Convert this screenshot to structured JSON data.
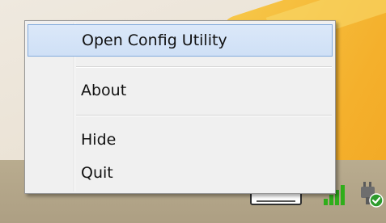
{
  "context_menu": {
    "items": [
      {
        "label": "Open Config Utility",
        "highlighted": true
      },
      {
        "label": "About",
        "highlighted": false
      },
      {
        "label": "Hide",
        "highlighted": false
      },
      {
        "label": "Quit",
        "highlighted": false
      }
    ]
  },
  "tray_icons": [
    "keyboard-icon",
    "signal-strength-icon",
    "power-check-icon"
  ],
  "colors": {
    "menu_background": "#f0f0f0",
    "highlight_fill": "#d5e4f7",
    "highlight_border": "#84acdd",
    "taskbar": "#b3a589",
    "wallpaper_accent": "#f4b02c",
    "signal_green": "#2fae1a",
    "check_green": "#2d9b2d"
  }
}
